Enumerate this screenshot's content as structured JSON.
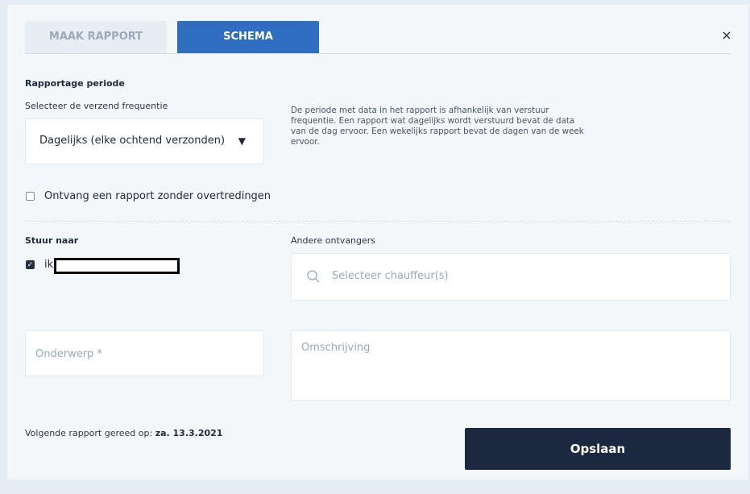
{
  "tabs": [
    {
      "label": "MAAK RAPPORT"
    },
    {
      "label": "SCHEMA"
    }
  ],
  "active_tab": "SCHEMA",
  "close_symbol": "×",
  "period": {
    "section_title": "Rapportage periode",
    "frequency_label": "Selecteer de verzend frequentie",
    "frequency_value": "Dagelijks (elke ochtend verzonden)",
    "caret_symbol": "▼",
    "info": "De periode met data in het rapport is afhankelijk van verstuur frequentie. Een rapport wat dagelijks wordt verstuurd bevat de data van de dag ervoor. Een wekelijks rapport bevat de dagen van de week ervoor."
  },
  "no_violations_checkbox": {
    "label": "Ontvang een rapport zonder overtredingen",
    "checked": false
  },
  "send_to": {
    "title": "Stuur naar",
    "self_label": "ik",
    "self_checked": true
  },
  "other_recipients": {
    "title": "Andere ontvangers",
    "placeholder": "Selecteer chauffeur(s)"
  },
  "subject": {
    "placeholder": "Onderwerp *"
  },
  "description": {
    "placeholder": "Omschrijving"
  },
  "footer": {
    "next_report_label": "Volgende rapport gereed op:",
    "next_report_date": "za. 13.3.2021",
    "save_label": "Opslaan"
  },
  "colors": {
    "active_tab": "#2f6ec0",
    "save_button": "#1b2840",
    "background": "#f3f7fa"
  }
}
